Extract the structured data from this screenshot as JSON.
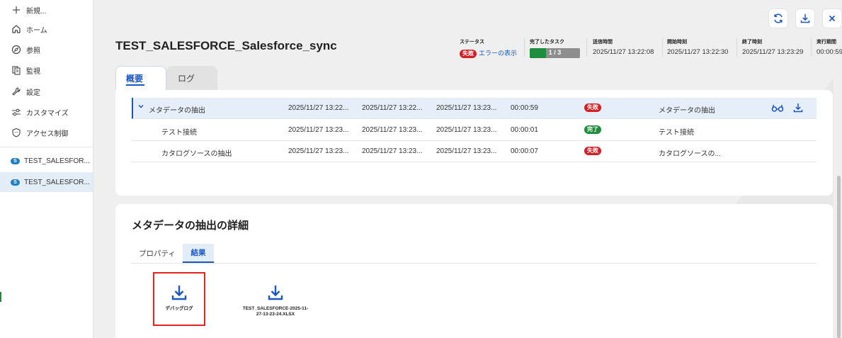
{
  "sidebar": {
    "new_label": "新規...",
    "items": [
      {
        "label": "ホーム",
        "icon": "home-icon"
      },
      {
        "label": "参照",
        "icon": "compass-icon"
      },
      {
        "label": "監視",
        "icon": "monitor-icon"
      },
      {
        "label": "設定",
        "icon": "wrench-icon"
      },
      {
        "label": "カスタマイズ",
        "icon": "sliders-icon"
      },
      {
        "label": "アクセス制御",
        "icon": "shield-icon"
      }
    ],
    "jobs": [
      {
        "label": "TEST_SALESFOR...",
        "icon": "salesforce-icon",
        "active": false
      },
      {
        "label": "TEST_SALESFOR...",
        "icon": "salesforce-icon",
        "active": true
      }
    ]
  },
  "header": {
    "title": "TEST_SALESFORCE_Salesforce_sync",
    "status_label": "ステータス",
    "status_badge": "失敗",
    "error_link": "エラーの表示",
    "tasks_label": "完了したタスク",
    "tasks_value": "1 / 3",
    "tasks_progress": 0.33,
    "sent_label": "送信時間",
    "sent_value": "2025/11/27 13:22:08",
    "start_label": "開始時刻",
    "start_value": "2025/11/27 13:22:30",
    "end_label": "終了時刻",
    "end_value": "2025/11/27 13:23:29",
    "duration_label": "実行期間",
    "duration_value": "00:00:59"
  },
  "tabs": [
    {
      "label": "概要",
      "active": true
    },
    {
      "label": "ログ",
      "active": false
    }
  ],
  "task_rows": [
    {
      "name": "メタデータの抽出",
      "sent": "2025/11/27 13:22...",
      "start": "2025/11/27 13:22...",
      "end": "2025/11/27 13:23...",
      "duration": "00:00:59",
      "status": "失敗",
      "desc": "メタデータの抽出"
    },
    {
      "name": "テスト接続",
      "sent": "2025/11/27 13:23...",
      "start": "2025/11/27 13:23...",
      "end": "2025/11/27 13:23...",
      "duration": "00:00:01",
      "status": "完了",
      "desc": "テスト接続"
    },
    {
      "name": "カタログソースの抽出",
      "sent": "2025/11/27 13:23...",
      "start": "2025/11/27 13:23...",
      "end": "2025/11/27 13:23...",
      "duration": "00:00:07",
      "status": "失敗",
      "desc": "カタログソースの..."
    }
  ],
  "details": {
    "title": "メタデータの抽出の詳細",
    "subtabs": [
      {
        "label": "プロパティ",
        "active": false
      },
      {
        "label": "結果",
        "active": true
      }
    ],
    "files": [
      {
        "name": "デバッグログ",
        "icon": "download-icon"
      },
      {
        "name": "TEST_SALESFORCE-2025-11-27-13-23-24.XLSX",
        "name_line1": "TEST_SALESFORCE-2025-11-",
        "name_line2": "27-13-23-24.XLSX",
        "icon": "download-icon"
      }
    ]
  },
  "colors": {
    "accent": "#1a56c4",
    "fail": "#d51f26",
    "success": "#1e8e3e",
    "highlight": "#e5221e"
  }
}
